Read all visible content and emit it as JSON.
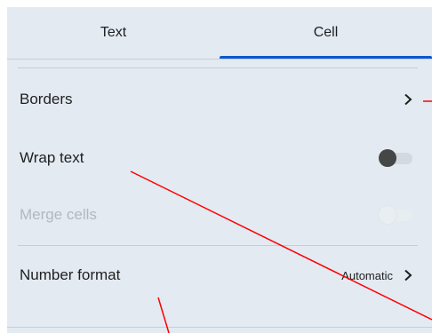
{
  "tabs": [
    {
      "label": "Text",
      "active": false
    },
    {
      "label": "Cell",
      "active": true
    }
  ],
  "rows": {
    "borders": {
      "label": "Borders"
    },
    "wrap_text": {
      "label": "Wrap text",
      "checked": false
    },
    "merge_cells": {
      "label": "Merge cells",
      "disabled": true,
      "checked": false
    },
    "number_format": {
      "label": "Number format",
      "value": "Automatic"
    }
  },
  "colors": {
    "panel_bg": "#e3eaf2",
    "accent": "#0b57d0",
    "annotation": "#ff0000"
  }
}
